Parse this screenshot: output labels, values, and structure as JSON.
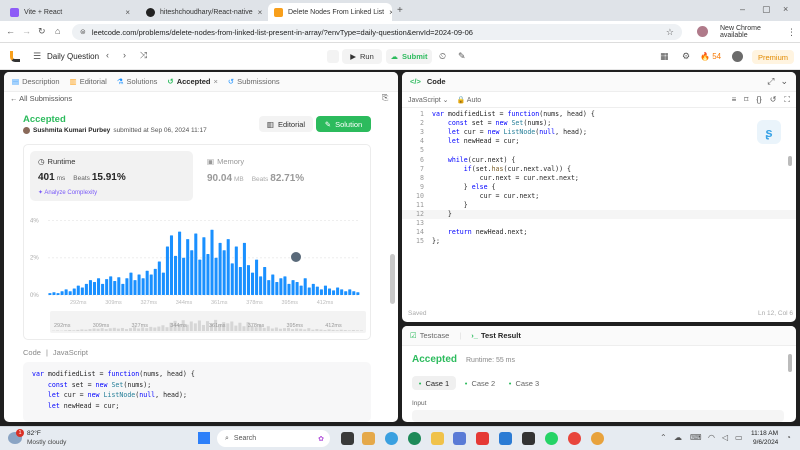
{
  "browser": {
    "tabs": [
      {
        "title": "Vite + React",
        "color": "#8e5cf7",
        "active": false
      },
      {
        "title": "hiteshchoudhary/React-native",
        "color": "#222222",
        "active": false
      },
      {
        "title": "Delete Nodes From Linked List",
        "color": "#f89f1b",
        "active": true
      }
    ],
    "url": "leetcode.com/problems/delete-nodes-from-linked-list-present-in-array/?envType=daily-question&envId=2024-09-06",
    "chrome_badge": "New Chrome available"
  },
  "header": {
    "daily": "Daily Question",
    "run": "Run",
    "submit": "Submit",
    "streak": "54",
    "premium": "Premium"
  },
  "left": {
    "tabs": {
      "description": "Description",
      "editorial": "Editorial",
      "solutions": "Solutions",
      "accepted": "Accepted",
      "submissions": "Submissions"
    },
    "back": "All Submissions",
    "status": "Accepted",
    "user": "Sushmita Kumari Purbey",
    "submitted": "submitted at Sep 06, 2024 11:17",
    "editorial_btn": "Editorial",
    "solution_btn": "Solution",
    "runtime_label": "Runtime",
    "runtime_value": "401",
    "runtime_unit": "ms",
    "beats_label": "Beats",
    "runtime_beats": "15.91%",
    "analyze": "Analyze Complexity",
    "memory_label": "Memory",
    "memory_value": "90.04",
    "memory_unit": "MB",
    "memory_beats": "82.71%",
    "code_label": "Code",
    "lang": "JavaScript",
    "code": [
      "var modifiedList = function(nums, head) {",
      "    const set = new Set(nums);",
      "    let cur = new ListNode(null, head);",
      "    let newHead = cur;"
    ]
  },
  "chart_data": {
    "type": "bar",
    "yticks": [
      "4%",
      "2%",
      "0%"
    ],
    "xticks": [
      "292ms",
      "309ms",
      "327ms",
      "344ms",
      "361ms",
      "378ms",
      "395ms",
      "412ms"
    ],
    "ylim": [
      0,
      4.4
    ],
    "values": [
      0.1,
      0.15,
      0.1,
      0.2,
      0.3,
      0.2,
      0.35,
      0.5,
      0.4,
      0.6,
      0.8,
      0.7,
      0.9,
      0.6,
      0.85,
      1.0,
      0.75,
      0.95,
      0.6,
      0.9,
      1.2,
      0.8,
      1.1,
      0.9,
      1.3,
      1.1,
      1.4,
      1.8,
      1.2,
      2.6,
      3.2,
      2.1,
      3.4,
      2.0,
      3.0,
      2.4,
      3.3,
      1.9,
      3.1,
      2.2,
      3.5,
      2.0,
      2.8,
      2.4,
      3.0,
      1.7,
      2.6,
      1.5,
      2.8,
      1.6,
      1.2,
      1.9,
      1.0,
      1.5,
      0.8,
      1.1,
      0.7,
      0.9,
      1.0,
      0.6,
      0.8,
      0.7,
      0.5,
      0.9,
      0.4,
      0.6,
      0.45,
      0.3,
      0.5,
      0.35,
      0.25,
      0.4,
      0.3,
      0.2,
      0.3,
      0.2,
      0.15
    ]
  },
  "editor": {
    "title": "Code",
    "lang": "JavaScript",
    "auto": "Auto",
    "lines": [
      "var modifiedList = function(nums, head) {",
      "    const set = new Set(nums);",
      "    let cur = new ListNode(null, head);",
      "    let newHead = cur;",
      "",
      "    while(cur.next) {",
      "        if(set.has(cur.next.val)) {",
      "            cur.next = cur.next.next;",
      "        } else {",
      "            cur = cur.next;",
      "        }",
      "    }",
      "",
      "    return newHead.next;",
      "};"
    ],
    "saved": "Saved",
    "cursor": "Ln 12, Col 6"
  },
  "result": {
    "testcase": "Testcase",
    "test_result": "Test Result",
    "status": "Accepted",
    "runtime": "Runtime: 55 ms",
    "cases": [
      "Case 1",
      "Case 2",
      "Case 3"
    ],
    "input": "Input"
  },
  "taskbar": {
    "temp": "82°F",
    "weather": "Mostly cloudy",
    "search": "Search",
    "time": "11:18 AM",
    "date": "9/6/2024",
    "badge": "1"
  }
}
